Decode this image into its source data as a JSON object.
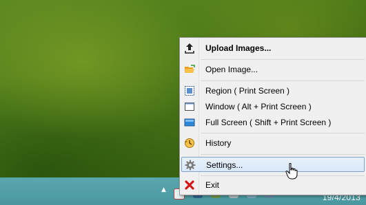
{
  "menu": {
    "items": [
      {
        "label": "Upload Images...",
        "icon": "upload-icon",
        "bold": true
      },
      {
        "label": "Open Image...",
        "icon": "open-folder-icon"
      },
      {
        "label": "Region ( Print Screen )",
        "icon": "region-icon"
      },
      {
        "label": "Window ( Alt + Print Screen )",
        "icon": "window-icon"
      },
      {
        "label": "Full Screen ( Shift + Print Screen )",
        "icon": "fullscreen-icon"
      },
      {
        "label": "History",
        "icon": "history-icon"
      },
      {
        "label": "Settings...",
        "icon": "gear-icon",
        "highlighted": true
      },
      {
        "label": "Exit",
        "icon": "close-icon"
      }
    ]
  },
  "taskbar": {
    "clock_date": "19/4/2013",
    "tray_overflow_icon": "chevron-up-icon"
  },
  "colors": {
    "desktop": "#4d7a1a",
    "taskbar": "#4a97a0",
    "menu_bg": "#f0f0f0",
    "hover_border": "#7da2ce",
    "exit_red": "#d01818"
  }
}
